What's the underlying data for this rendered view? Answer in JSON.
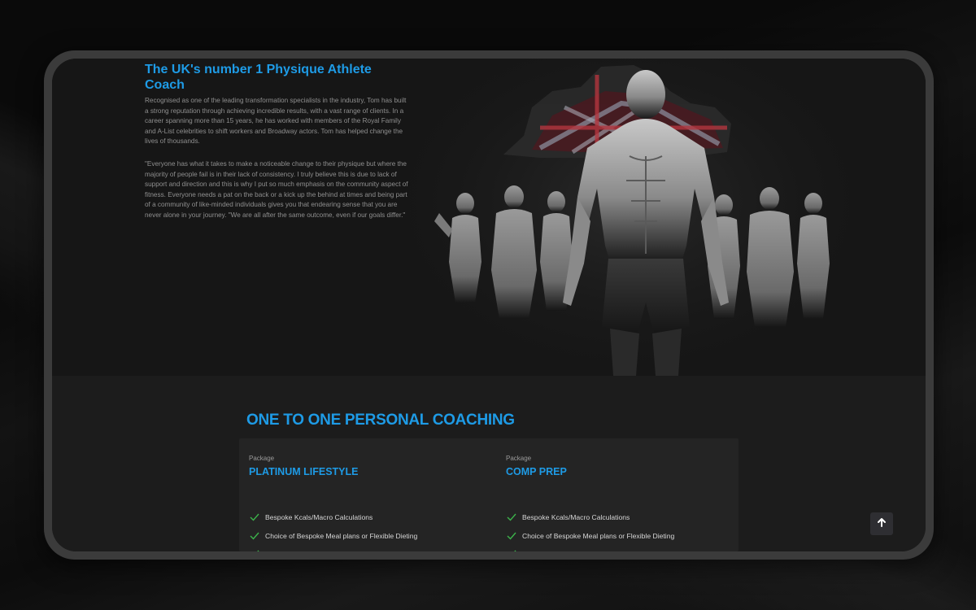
{
  "hero": {
    "title": "The UK's number 1 Physique Athlete Coach",
    "paragraph_1": "Recognised as one of the leading transformation specialists in the industry, Tom has built a strong reputation through achieving incredible results, with a vast range of clients. In a career spanning more than 15 years, he has worked with members of the Royal Family and A-List celebrities to shift workers and Broadway actors. Tom has helped change the lives of thousands.",
    "paragraph_2": "\"Everyone has what it takes to make a noticeable change to their physique but where the majority of people fail is in their lack of consistency. I truly believe this is due to lack of support and direction and this is why I put so much emphasis on the community aspect of fitness. Everyone needs a pat on the back or a kick up the behind at times and being part of a community of like-minded individuals gives you that endearing sense that you are never alone in your journey. \"We are all after the same outcome, even if our goals differ.\""
  },
  "coaching": {
    "section_title": "ONE TO ONE PERSONAL COACHING",
    "packages": [
      {
        "kicker": "Package",
        "name": "PLATINUM LIFESTYLE",
        "features": [
          "Bespoke Kcals/Macro Calculations",
          "Choice of Bespoke Meal plans or Flexible Dieting"
        ]
      },
      {
        "kicker": "Package",
        "name": "COMP PREP",
        "features": [
          "Bespoke Kcals/Macro Calculations",
          "Choice of Bespoke Meal plans or Flexible Dieting"
        ]
      }
    ]
  },
  "colors": {
    "accent": "#1e9be6",
    "check": "#3cb44b",
    "background": "#161616",
    "device_frame": "#3b3b3b"
  },
  "icons": {
    "check": "check-icon",
    "scroll_top": "arrow-up-icon"
  }
}
